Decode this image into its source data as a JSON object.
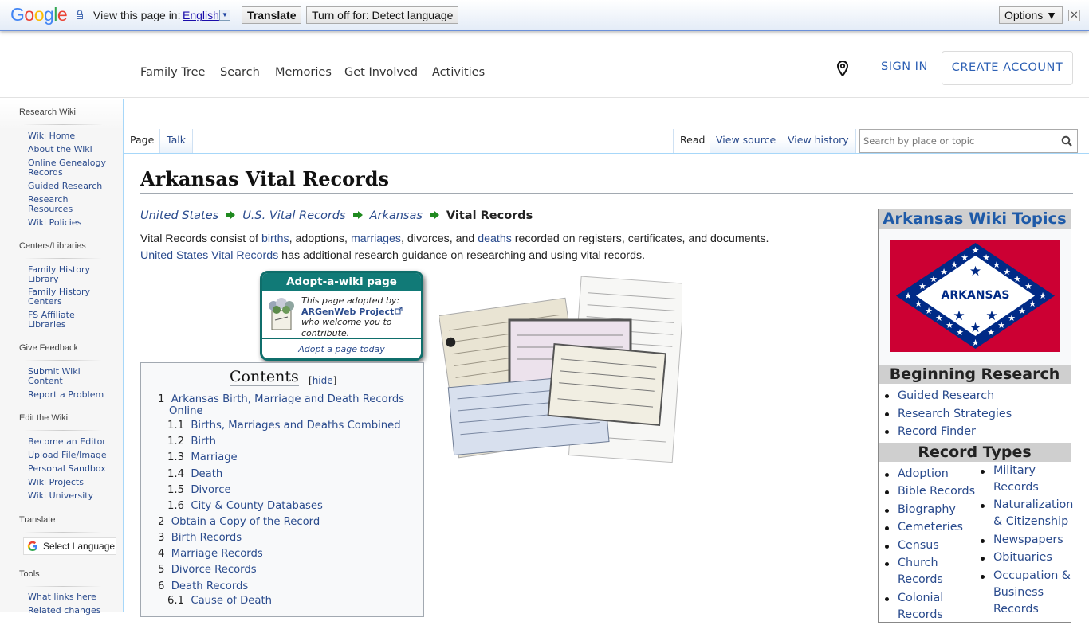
{
  "translate_bar": {
    "logo": [
      "G",
      "o",
      "o",
      "g",
      "l",
      "e"
    ],
    "logo_colors": [
      "#4285f4",
      "#ea4335",
      "#fbbc05",
      "#4285f4",
      "#34a853",
      "#ea4335"
    ],
    "label": "View this page in:",
    "language": "English",
    "translate_button": "Translate",
    "turn_off_button": "Turn off for: Detect language",
    "options_button": "Options ▼",
    "close": "✕"
  },
  "header": {
    "nav": [
      "Family Tree",
      "Search",
      "Memories",
      "Get Involved",
      "Activities"
    ],
    "sign_in": "SIGN IN",
    "create_account": "CREATE ACCOUNT",
    "link_color": "#2d60b4"
  },
  "sidebar": {
    "sections": [
      {
        "title": "Research Wiki",
        "items": [
          "Wiki Home",
          "About the Wiki",
          "Online Genealogy Records",
          "Guided Research",
          "Research Resources",
          "Wiki Policies"
        ]
      },
      {
        "title": "Centers/Libraries",
        "items": [
          "Family History Library",
          "Family History Centers",
          "FS Affiliate Libraries"
        ]
      },
      {
        "title": "Give Feedback",
        "items": [
          "Submit Wiki Content",
          "Report a Problem"
        ]
      },
      {
        "title": "Edit the Wiki",
        "items": [
          "Become an Editor",
          "Upload File/Image",
          "Personal Sandbox",
          "Wiki Projects",
          "Wiki University"
        ]
      },
      {
        "title": "Translate",
        "items": []
      },
      {
        "title": "Tools",
        "items": [
          "What links here",
          "Related changes"
        ]
      }
    ],
    "select_language": "Select Language"
  },
  "tabs": {
    "left": [
      "Page",
      "Talk"
    ],
    "right": [
      "Read",
      "View source",
      "View history"
    ],
    "search_placeholder": "Search by place or topic"
  },
  "page": {
    "title": "Arkansas Vital Records",
    "breadcrumb": [
      "United States",
      "U.S. Vital Records",
      "Arkansas"
    ],
    "breadcrumb_current": "Vital Records",
    "intro": {
      "p1": "Vital Records consist of ",
      "births": "births",
      "p2": ", adoptions, ",
      "marriages": "marriages",
      "p3": ", divorces, and ",
      "deaths": "deaths",
      "p4": " recorded on registers, certificates, and documents.",
      "usvr": "United States Vital Records",
      "p5": " has additional research guidance on researching and using vital records."
    }
  },
  "adopt": {
    "heading": "Adopt-a-wiki page",
    "line1": "This page adopted by:",
    "project": "ARGenWeb Project",
    "line2": "who welcome you to",
    "line3": "contribute.",
    "footer": "Adopt a page today",
    "color": "#117a77"
  },
  "toc": {
    "heading": "Contents",
    "hide": "hide",
    "items": [
      {
        "num": "1",
        "text": "Arkansas Birth, Marriage and Death Records",
        "text2": "Online"
      },
      {
        "num": "1.1",
        "text": "Births, Marriages and Deaths Combined"
      },
      {
        "num": "1.2",
        "text": "Birth"
      },
      {
        "num": "1.3",
        "text": "Marriage"
      },
      {
        "num": "1.4",
        "text": "Death"
      },
      {
        "num": "1.5",
        "text": "Divorce"
      },
      {
        "num": "1.6",
        "text": "City & County Databases"
      },
      {
        "num": "2",
        "text": "Obtain a Copy of the Record"
      },
      {
        "num": "3",
        "text": "Birth Records"
      },
      {
        "num": "4",
        "text": "Marriage Records"
      },
      {
        "num": "5",
        "text": "Divorce Records"
      },
      {
        "num": "6",
        "text": "Death Records"
      },
      {
        "num": "6.1",
        "text": "Cause of Death"
      }
    ]
  },
  "infobox": {
    "title": "Arkansas Wiki Topics",
    "flag_text": "ARKANSAS",
    "beginning_heading": "Beginning Research",
    "beginning": [
      "Guided Research",
      "Research Strategies",
      "Record Finder"
    ],
    "record_types_heading": "Record Types",
    "col1": [
      "Adoption",
      "Bible Records",
      "Biography",
      "Cemeteries",
      "Census",
      "Church Records",
      "Colonial Records"
    ],
    "col2": [
      "Military Records",
      "Naturalization & Citizenship",
      "Newspapers",
      "Obituaries",
      "Occupation & Business Records"
    ]
  }
}
